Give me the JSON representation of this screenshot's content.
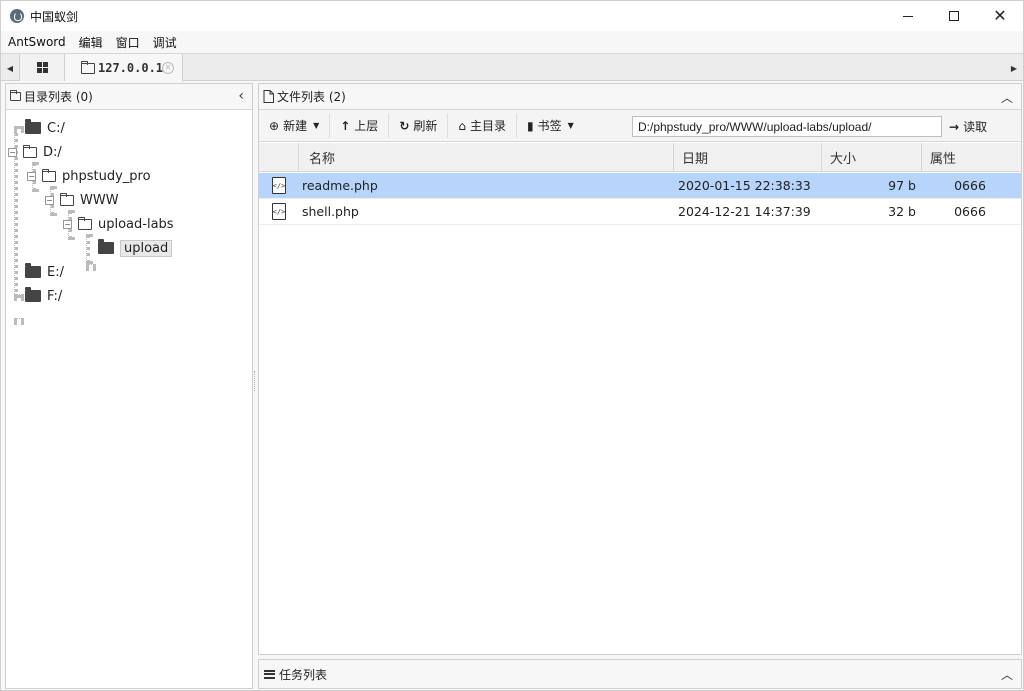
{
  "window": {
    "title": "中国蚁剑"
  },
  "menu": [
    "AntSword",
    "编辑",
    "窗口",
    "调试"
  ],
  "tabs": {
    "active_label": "127.0.0.1"
  },
  "left": {
    "title": "目录列表 (0)",
    "tree": {
      "c": "C:/",
      "d": "D:/",
      "phpstudy": "phpstudy_pro",
      "www": "WWW",
      "uploadlabs": "upload-labs",
      "upload": "upload",
      "e": "E:/",
      "f": "F:/"
    }
  },
  "right": {
    "title": "文件列表 (2)",
    "toolbar": {
      "new": "新建",
      "up": "上层",
      "refresh": "刷新",
      "home": "主目录",
      "bookmark": "书签",
      "path": "D:/phpstudy_pro/WWW/upload-labs/upload/",
      "read": "读取"
    },
    "columns": {
      "name": "名称",
      "date": "日期",
      "size": "大小",
      "attr": "属性"
    },
    "files": [
      {
        "name": "readme.php",
        "date": "2020-01-15 22:38:33",
        "size": "97 b",
        "attr": "0666"
      },
      {
        "name": "shell.php",
        "date": "2024-12-21 14:37:39",
        "size": "32 b",
        "attr": "0666"
      }
    ]
  },
  "tasks": {
    "title": "任务列表"
  },
  "colors": {
    "selected_row": "#b7d4fb",
    "folder": "#444444"
  }
}
